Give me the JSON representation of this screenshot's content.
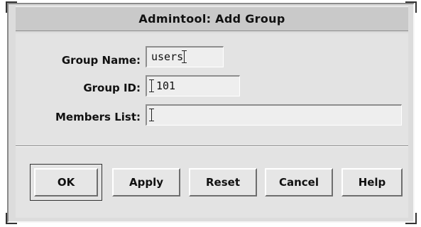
{
  "window": {
    "title": "Admintool: Add Group"
  },
  "form": {
    "group_name": {
      "label": "Group Name:",
      "value": "users"
    },
    "group_id": {
      "label": "Group ID:",
      "value": "101"
    },
    "members_list": {
      "label": "Members List:",
      "value": ""
    }
  },
  "buttons": {
    "ok": "OK",
    "apply": "Apply",
    "reset": "Reset",
    "cancel": "Cancel",
    "help": "Help"
  }
}
